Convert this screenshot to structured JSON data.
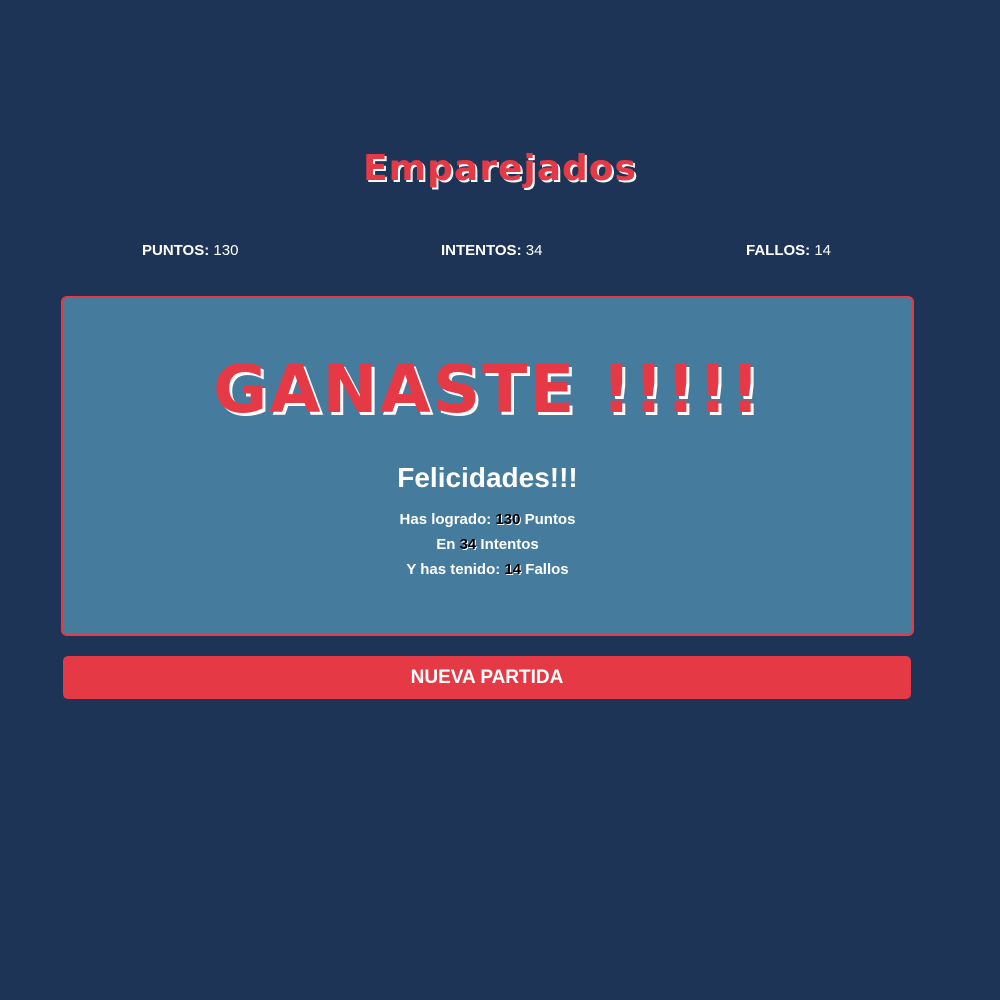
{
  "header": {
    "title": "Emparejados"
  },
  "stats": {
    "puntos_label": "PUNTOS:",
    "puntos_value": "130",
    "intentos_label": "INTENTOS:",
    "intentos_value": "34",
    "fallos_label": "FALLOS:",
    "fallos_value": "14"
  },
  "result": {
    "title": "GANASTE !!!!!",
    "subtitle": "Felicidades!!!",
    "line1_prefix": "Has logrado:",
    "line1_value": "130",
    "line1_suffix": "Puntos",
    "line2_prefix": "En",
    "line2_value": "34",
    "line2_suffix": "Intentos",
    "line3_prefix": "Y has tenido:",
    "line3_value": "14",
    "line3_suffix": "Fallos"
  },
  "actions": {
    "new_game_label": "NUEVA PARTIDA"
  },
  "colors": {
    "background": "#1e3456",
    "accent": "#e63946",
    "panel": "#457b9d",
    "text": "#ffffff"
  }
}
